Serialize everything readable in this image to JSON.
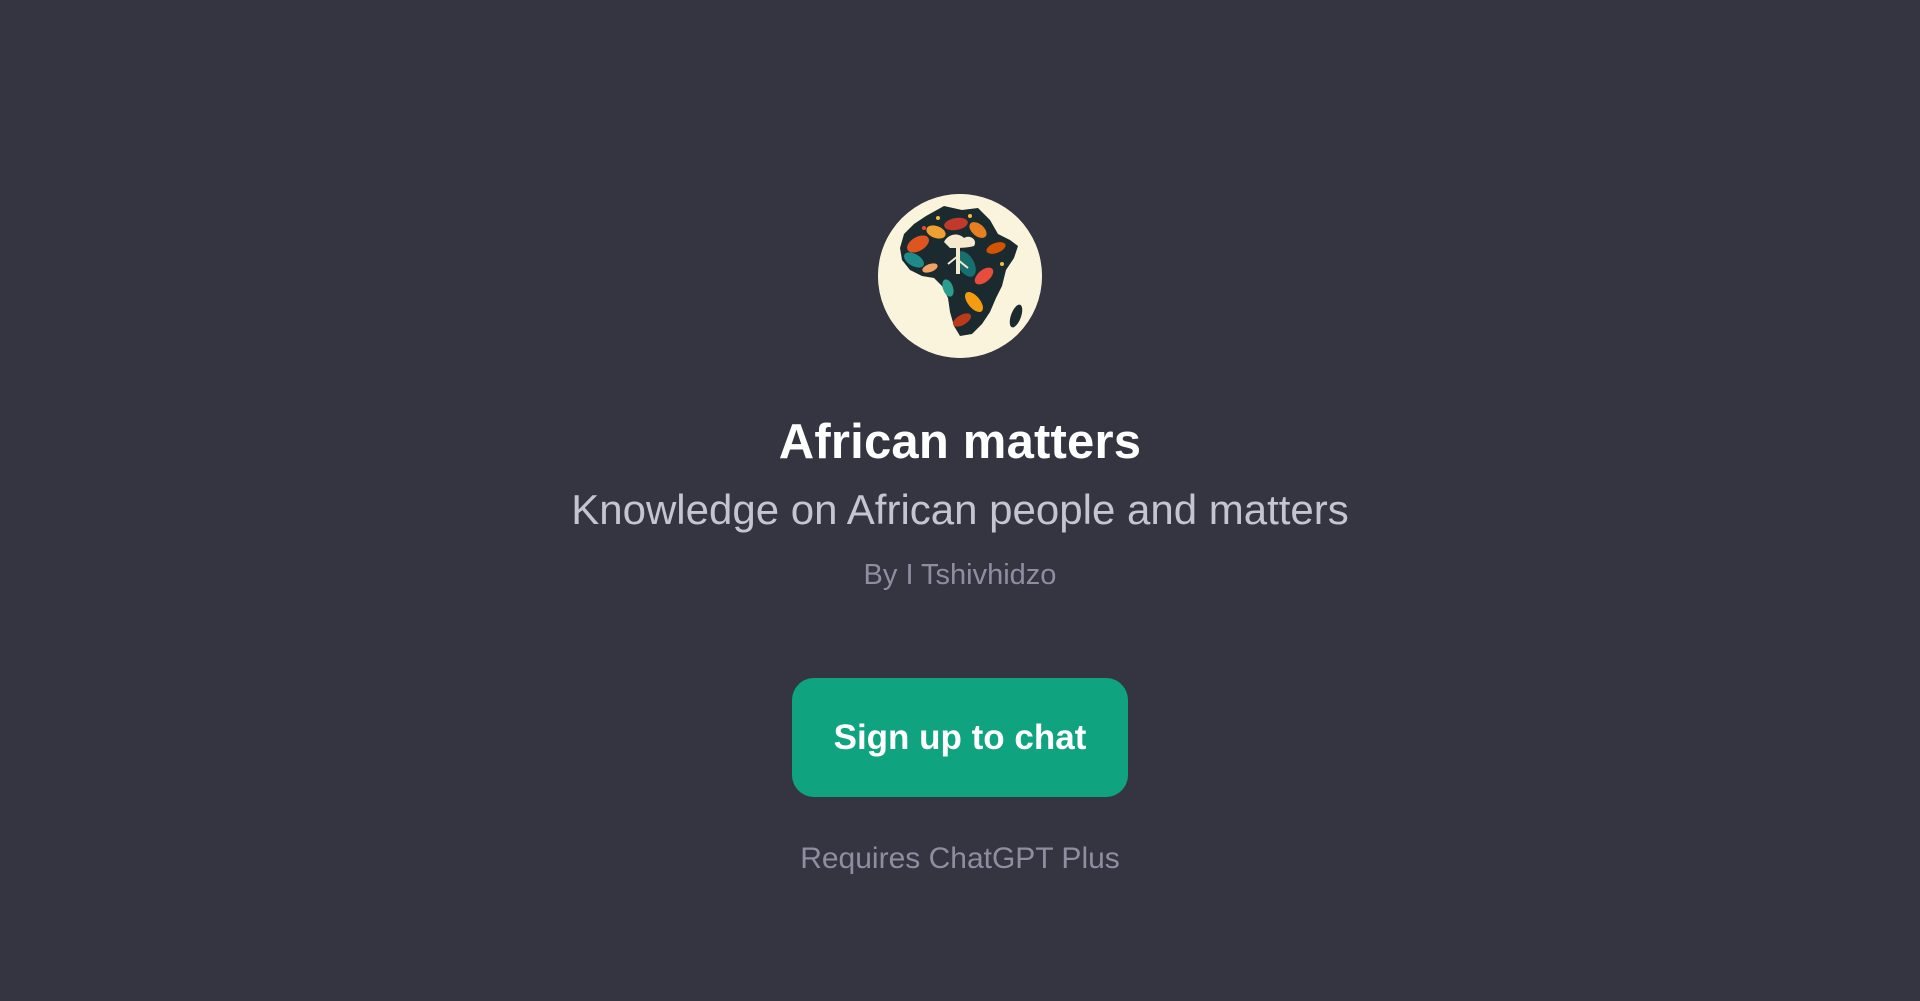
{
  "gpt": {
    "name": "African matters",
    "description": "Knowledge on African people and matters",
    "author": "By I Tshivhidzo",
    "avatar_icon": "africa-map-illustration-icon"
  },
  "actions": {
    "signup_label": "Sign up to chat"
  },
  "footer": {
    "requirement": "Requires ChatGPT Plus"
  },
  "colors": {
    "background": "#343541",
    "accent": "#10a37f",
    "title": "#ffffff",
    "subtitle": "#c5c5d2",
    "muted": "#8e8ea0"
  }
}
